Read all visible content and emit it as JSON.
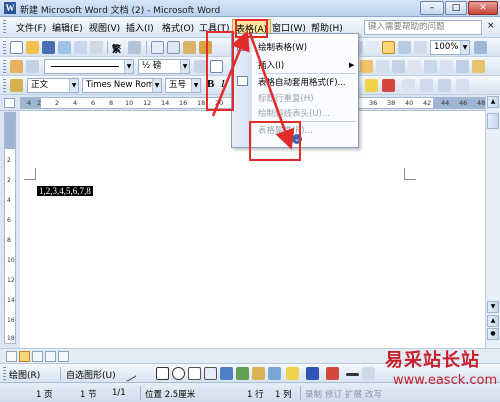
{
  "window": {
    "title": "新建 Microsoft Word 文档 (2) - Microsoft Word",
    "minimize": "–",
    "maximize": "□",
    "close": "✕"
  },
  "menubar": {
    "items": [
      "文件(F)",
      "编辑(E)",
      "视图(V)",
      "插入(I)",
      "格式(O)",
      "工具(T)",
      "表格(A)",
      "窗口(W)",
      "帮助(H)"
    ],
    "active": "表格(A)",
    "help_placeholder": "键入需要帮助的问题",
    "help_close": "×"
  },
  "toolbar": {
    "font_name": "Times New Roman",
    "font_size": "五号",
    "style": "正文",
    "line_spacing": "½ 磅",
    "zoom": "100%",
    "align_traditional": "繁",
    "bold": "B",
    "italic": "I"
  },
  "table_menu": {
    "items": [
      {
        "label": "绘制表格(W)",
        "disabled": false
      },
      {
        "label": "插入(I)",
        "disabled": false,
        "submenu": true
      },
      {
        "label": "表格自动套用格式(F)...",
        "disabled": false
      },
      {
        "label": "标题行重复(H)",
        "disabled": true
      },
      {
        "label": "绘制斜线表头(U)...",
        "disabled": true
      },
      {
        "label": "表格属性(R)...",
        "disabled": true
      }
    ],
    "expand_icon": "⌄",
    "submenu_arrow": "▶"
  },
  "ruler": {
    "numbers": [
      "4",
      "2",
      "2",
      "4",
      "6",
      "8",
      "10",
      "12",
      "14",
      "16",
      "18",
      "20",
      "36",
      "38",
      "40",
      "42",
      "44",
      "46",
      "48"
    ],
    "vertical": [
      "2",
      "2",
      "4",
      "6",
      "8",
      "10",
      "12",
      "14",
      "16",
      "18"
    ]
  },
  "document": {
    "selected_text": "1,2,3,4,5,6,7,8"
  },
  "drawing_toolbar": {
    "draw": "绘图(R)",
    "autoshapes": "自选图形(U)"
  },
  "statusbar": {
    "page": "1 页",
    "section": "1 节",
    "pages": "1/1",
    "position": "位置 2.5厘米",
    "line": "1 行",
    "column": "1 列",
    "rec": "录制",
    "trk": "修订",
    "ext": "扩展",
    "ovr": "改写"
  },
  "watermark": {
    "site_name": "易采站长站",
    "url": "www.easck.com"
  },
  "colors": {
    "annotation": "#e22b2b",
    "menu_highlight": "#ffe59a",
    "watermark": "#c7202b"
  }
}
